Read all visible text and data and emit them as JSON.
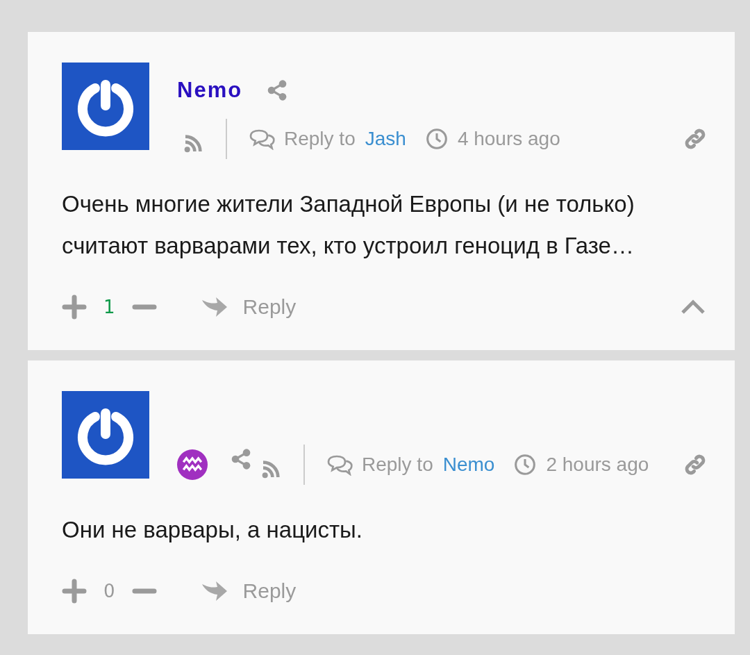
{
  "comments": [
    {
      "kind": "named",
      "author": "Nemo",
      "reply_label": "Reply to",
      "reply_to": "Jash",
      "time": "4 hours ago",
      "text": "Очень многие жители Западной Европы (и не только) считают варварами тех, кто устроил геноцид в Газе…",
      "score": "1",
      "color": "#109a4a",
      "reply": "Reply",
      "collapsible": true
    },
    {
      "kind": "zodiac",
      "reply_label": "Reply to",
      "reply_to": "Nemo",
      "time": "2 hours ago",
      "text": "Они не варвары, а нацисты.",
      "score": "0",
      "color": "#9a9a9a",
      "reply": "Reply",
      "collapsible": false
    }
  ]
}
